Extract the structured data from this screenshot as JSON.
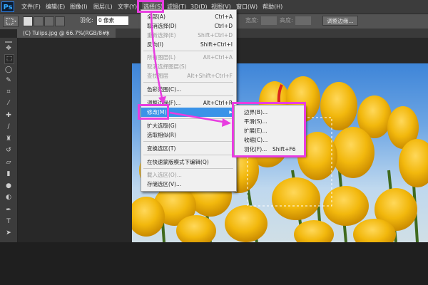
{
  "menubar": {
    "logo": "Ps",
    "items": [
      "文件(F)",
      "编辑(E)",
      "图像(I)",
      "图层(L)",
      "文字(Y)",
      "选择(S)",
      "滤镜(T)",
      "3D(D)",
      "视图(V)",
      "窗口(W)",
      "帮助(H)"
    ]
  },
  "options": {
    "feather_label": "羽化:",
    "feather_value": "0 像素",
    "width_label": "宽度:",
    "height_label": "高度:",
    "refine_edge": "调整边缘..."
  },
  "document": {
    "tab_title": "(C) Tulips.jpg @ 66.7%(RGB/8#)",
    "close": "×"
  },
  "select_menu": {
    "items": [
      {
        "label": "全部(A)",
        "shortcut": "Ctrl+A",
        "disabled": false
      },
      {
        "label": "取消选择(D)",
        "shortcut": "Ctrl+D",
        "disabled": false
      },
      {
        "label": "重新选择(E)",
        "shortcut": "Shift+Ctrl+D",
        "disabled": true
      },
      {
        "label": "反向(I)",
        "shortcut": "Shift+Ctrl+I",
        "disabled": false
      },
      {
        "label": "所有图层(L)",
        "shortcut": "Alt+Ctrl+A",
        "disabled": true
      },
      {
        "label": "取消选择图层(S)",
        "shortcut": "",
        "disabled": true
      },
      {
        "label": "查找图层",
        "shortcut": "Alt+Shift+Ctrl+F",
        "disabled": true
      },
      {
        "label": "色彩范围(C)...",
        "shortcut": "",
        "disabled": false
      },
      {
        "label": "调整边缘(F)...",
        "shortcut": "Alt+Ctrl+R",
        "disabled": false
      },
      {
        "label": "修改(M)",
        "shortcut": "",
        "disabled": false
      },
      {
        "label": "扩大选取(G)",
        "shortcut": "",
        "disabled": false
      },
      {
        "label": "选取相似(R)",
        "shortcut": "",
        "disabled": false
      },
      {
        "label": "变换选区(T)",
        "shortcut": "",
        "disabled": false
      },
      {
        "label": "在快速蒙版模式下编辑(Q)",
        "shortcut": "",
        "disabled": false
      },
      {
        "label": "载入选区(O)...",
        "shortcut": "",
        "disabled": true
      },
      {
        "label": "存储选区(V)...",
        "shortcut": "",
        "disabled": false
      }
    ]
  },
  "modify_submenu": {
    "items": [
      {
        "label": "边界(B)...",
        "shortcut": ""
      },
      {
        "label": "平滑(S)...",
        "shortcut": ""
      },
      {
        "label": "扩展(E)...",
        "shortcut": ""
      },
      {
        "label": "收缩(C)...",
        "shortcut": ""
      },
      {
        "label": "羽化(F)...",
        "shortcut": "Shift+F6"
      }
    ]
  },
  "colors": {
    "highlight": "#e83de0",
    "menu_selection": "#3a93e8",
    "tulip_yellow": "#f2b80d"
  }
}
